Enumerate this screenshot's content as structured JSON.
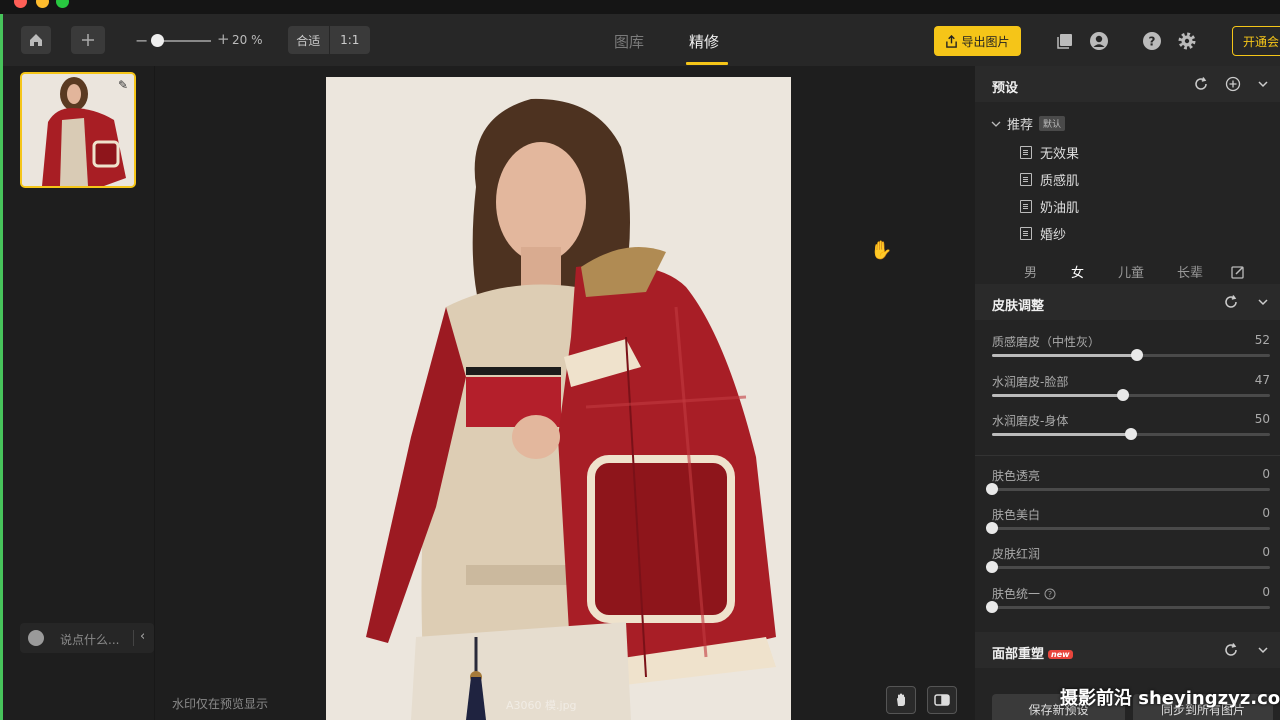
{
  "toolbar": {
    "zoom_percent": "20 %",
    "fit_label": "合适",
    "one_to_one_label": "1:1",
    "tabs": [
      {
        "label": "图库",
        "active": false
      },
      {
        "label": "精修",
        "active": true
      }
    ],
    "export_label": "导出图片",
    "vip_label": "开通会"
  },
  "left_panel": {
    "comment_placeholder": "说点什么..."
  },
  "canvas": {
    "watermark_note": "水印仅在预览显示",
    "file_label": "A3060 模.jpg"
  },
  "right_panel": {
    "presets": {
      "title": "预设",
      "group_label": "推荐",
      "group_badge": "默认",
      "items": [
        "无效果",
        "质感肌",
        "奶油肌",
        "婚纱"
      ]
    },
    "gender_tabs": [
      {
        "label": "男",
        "active": false
      },
      {
        "label": "女",
        "active": true
      },
      {
        "label": "儿童",
        "active": false
      },
      {
        "label": "长辈",
        "active": false
      }
    ],
    "skin": {
      "title": "皮肤调整",
      "sliders": [
        {
          "label": "质感磨皮（中性灰）",
          "value": 52
        },
        {
          "label": "水润磨皮-脸部",
          "value": 47
        },
        {
          "label": "水润磨皮-身体",
          "value": 50
        },
        {
          "label": "肤色透亮",
          "value": 0
        },
        {
          "label": "肤色美白",
          "value": 0
        },
        {
          "label": "皮肤红润",
          "value": 0
        },
        {
          "label": "肤色统一",
          "value": 0
        }
      ]
    },
    "face": {
      "title": "面部重塑",
      "badge": "new"
    },
    "bottom_buttons": [
      "保存新预设",
      "同步到所有图片"
    ]
  },
  "site_watermark": "摄影前沿 sheyingzyz.com",
  "colors": {
    "accent": "#f5c518",
    "panel": "#242424",
    "background": "#1e1e1e"
  }
}
